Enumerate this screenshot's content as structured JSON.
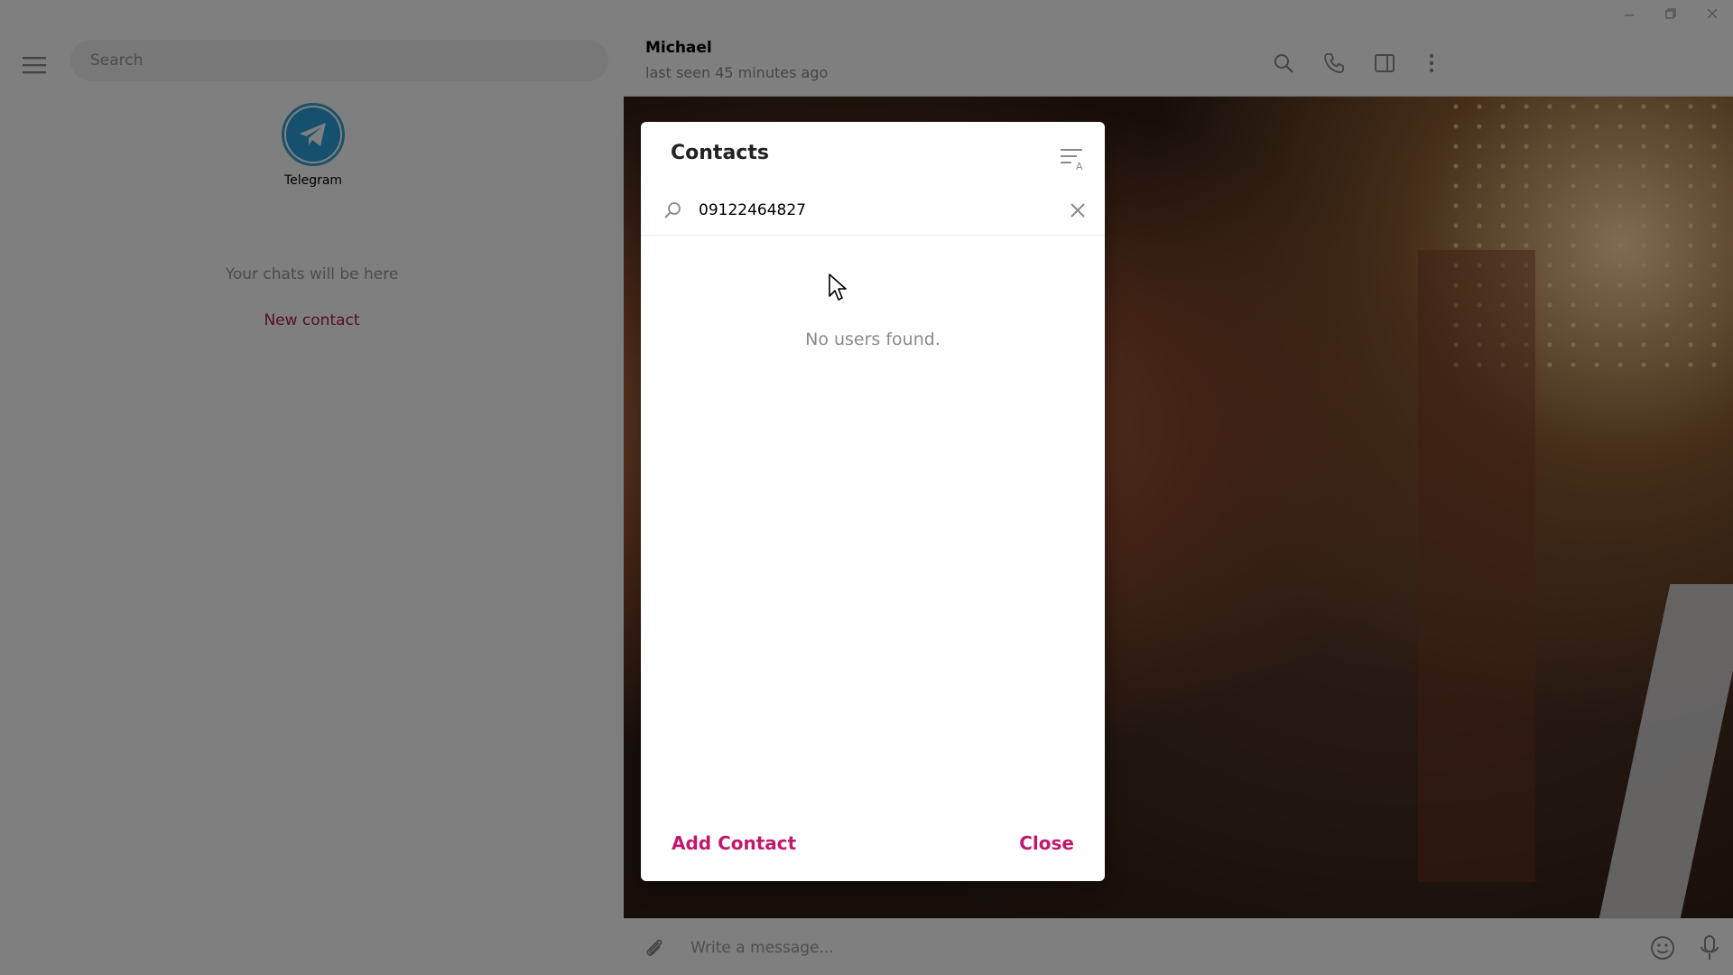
{
  "window": {
    "controls": [
      "minimize",
      "restore",
      "close"
    ]
  },
  "sidebar": {
    "search_placeholder": "Search",
    "story": {
      "label": "Telegram"
    },
    "empty_text": "Your chats will be here",
    "new_contact": "New contact"
  },
  "chat": {
    "name": "Michael",
    "status": "last seen 45 minutes ago",
    "compose_placeholder": "Write a message..."
  },
  "modal": {
    "title": "Contacts",
    "search_value": "09122464827",
    "empty_message": "No users found.",
    "add_contact": "Add Contact",
    "close": "Close"
  },
  "colors": {
    "accent": "#c2186b",
    "new_contact": "#b01a4e",
    "telegram_blue": "#2aa3dc"
  },
  "icons": {
    "titlebar": [
      "minimize-icon",
      "restore-icon",
      "close-icon"
    ],
    "sidebar": [
      "hamburger-menu-icon",
      "telegram-plane-icon"
    ],
    "header": [
      "search-icon",
      "phone-icon",
      "sidebar-toggle-icon",
      "more-vertical-icon"
    ],
    "modal": [
      "sort-alpha-icon",
      "search-icon",
      "clear-icon"
    ],
    "compose": [
      "paperclip-icon",
      "emoji-icon",
      "microphone-icon"
    ]
  }
}
